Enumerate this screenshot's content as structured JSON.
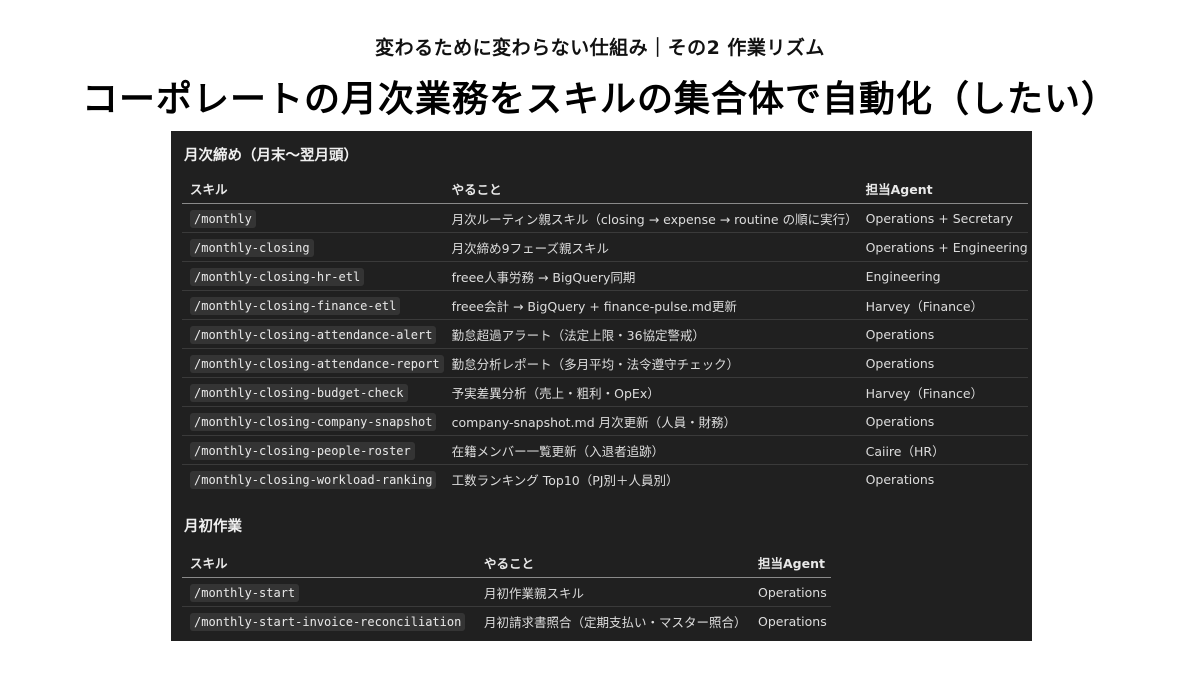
{
  "header": {
    "subtitle": "変わるために変わらない仕組み｜その2 作業リズム",
    "title": "コーポレートの月次業務をスキルの集合体で自動化（したい）"
  },
  "monthly_closing": {
    "heading": "月次締め（月末〜翌月頭）",
    "columns": [
      "スキル",
      "やること",
      "担当Agent"
    ],
    "rows": [
      {
        "skill": "/monthly",
        "task": "月次ルーティン親スキル（closing → expense → routine の順に実行）",
        "agent": "Operations + Secretary"
      },
      {
        "skill": "/monthly-closing",
        "task": "月次締め9フェーズ親スキル",
        "agent": "Operations + Engineering"
      },
      {
        "skill": "/monthly-closing-hr-etl",
        "task": "freee人事労務 → BigQuery同期",
        "agent": "Engineering"
      },
      {
        "skill": "/monthly-closing-finance-etl",
        "task": "freee会計 → BigQuery + finance-pulse.md更新",
        "agent": "Harvey（Finance）"
      },
      {
        "skill": "/monthly-closing-attendance-alert",
        "task": "勤怠超過アラート（法定上限・36協定警戒）",
        "agent": "Operations"
      },
      {
        "skill": "/monthly-closing-attendance-report",
        "task": "勤怠分析レポート（多月平均・法令遵守チェック）",
        "agent": "Operations"
      },
      {
        "skill": "/monthly-closing-budget-check",
        "task": "予実差異分析（売上・粗利・OpEx）",
        "agent": "Harvey（Finance）"
      },
      {
        "skill": "/monthly-closing-company-snapshot",
        "task": "company-snapshot.md 月次更新（人員・財務）",
        "agent": "Operations"
      },
      {
        "skill": "/monthly-closing-people-roster",
        "task": "在籍メンバー一覧更新（入退者追跡）",
        "agent": "Caiire（HR）"
      },
      {
        "skill": "/monthly-closing-workload-ranking",
        "task": "工数ランキング Top10（PJ別＋人員別）",
        "agent": "Operations"
      }
    ]
  },
  "monthly_start": {
    "heading": "月初作業",
    "columns": [
      "スキル",
      "やること",
      "担当Agent"
    ],
    "rows": [
      {
        "skill": "/monthly-start",
        "task": "月初作業親スキル",
        "agent": "Operations"
      },
      {
        "skill": "/monthly-start-invoice-reconciliation",
        "task": "月初請求書照合（定期支払い・マスター照合）",
        "agent": "Operations"
      }
    ]
  }
}
